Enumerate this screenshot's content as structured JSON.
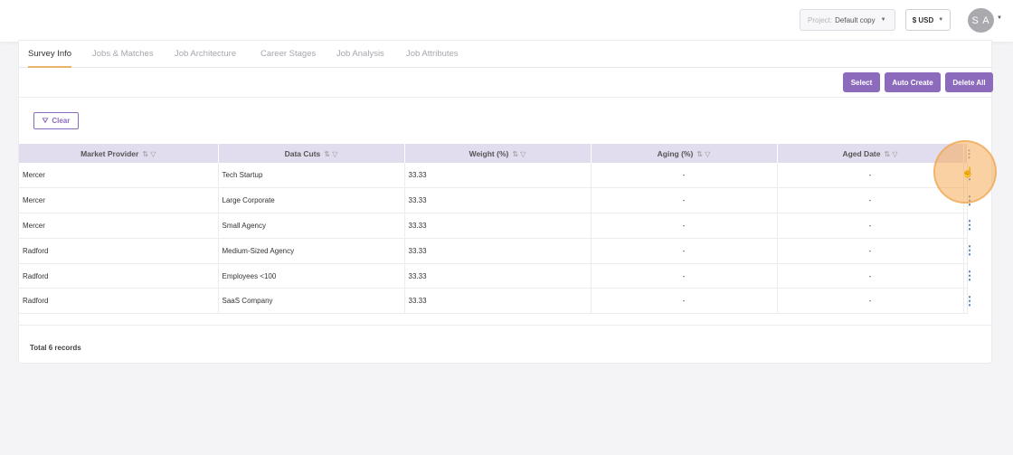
{
  "topbar": {
    "project_label": "Project:",
    "project_value": "Default copy",
    "currency": "$ USD",
    "avatar_initials": "S A"
  },
  "tabs": [
    {
      "label": "Survey Info",
      "active": true
    },
    {
      "label": "Jobs & Matches",
      "active": false
    },
    {
      "label": "Job Architecture",
      "active": false
    },
    {
      "label": "Career Stages",
      "active": false
    },
    {
      "label": "Job Analysis",
      "active": false
    },
    {
      "label": "Job Attributes",
      "active": false
    }
  ],
  "actions": {
    "select": "Select",
    "auto_create": "Auto Create",
    "delete_all": "Delete All",
    "clear": "Clear"
  },
  "table": {
    "columns": [
      "Market Provider",
      "Data Cuts",
      "Weight (%)",
      "Aging (%)",
      "Aged Date"
    ],
    "rows": [
      [
        "Mercer",
        "Tech Startup",
        "33.33",
        "-",
        "-"
      ],
      [
        "Mercer",
        "Large Corporate",
        "33.33",
        "-",
        "-"
      ],
      [
        "Mercer",
        "Small Agency",
        "33.33",
        "-",
        "-"
      ],
      [
        "Radford",
        "Medium-Sized Agency",
        "33.33",
        "-",
        "-"
      ],
      [
        "Radford",
        "Employees <100",
        "33.33",
        "-",
        "-"
      ],
      [
        "Radford",
        "SaaS Company",
        "33.33",
        "-",
        "-"
      ]
    ]
  },
  "footer": {
    "total": "Total 6 records"
  },
  "colors": {
    "accent": "#8c6bbd",
    "header_bg": "#e2dcef",
    "tab_underline": "#e8b46a",
    "highlight": "#f4ab56"
  }
}
